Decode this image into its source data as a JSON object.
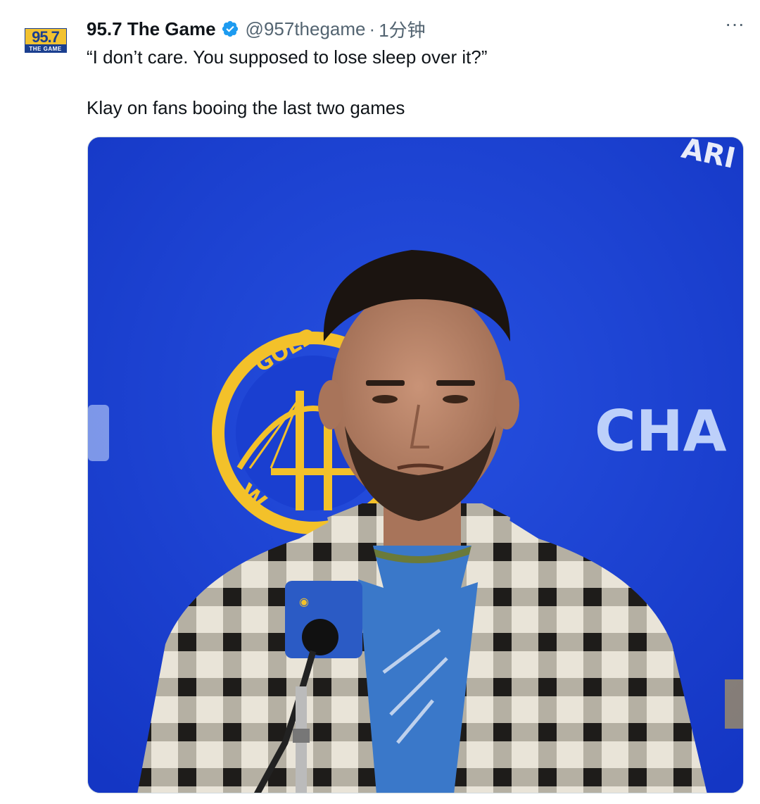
{
  "tweet": {
    "avatar": {
      "icon": "station-logo-icon",
      "logo_frequency": "95.7",
      "logo_station": "THE GAME"
    },
    "display_name": "95.7 The Game",
    "verified_icon": "verified-badge-icon",
    "handle": "@957thegame",
    "separator": "·",
    "time": "1分钟",
    "more_icon": "more-options-icon",
    "more_label": "···",
    "quote_text": "“I don’t care. You supposed to lose sleep over it?”",
    "caption_text": "Klay on fans booing the last two games"
  },
  "media": {
    "background_color": "#1a3fd0",
    "backdrop_text_top_right": "ARI",
    "backdrop_text_right": "CHA",
    "logo_text_top": "GOLD",
    "logo_text_bottom": "W",
    "colors": {
      "backdrop_blue": "#1a3fd0",
      "warriors_gold": "#f3c12a",
      "verified_blue": "#1d9bf0"
    }
  }
}
